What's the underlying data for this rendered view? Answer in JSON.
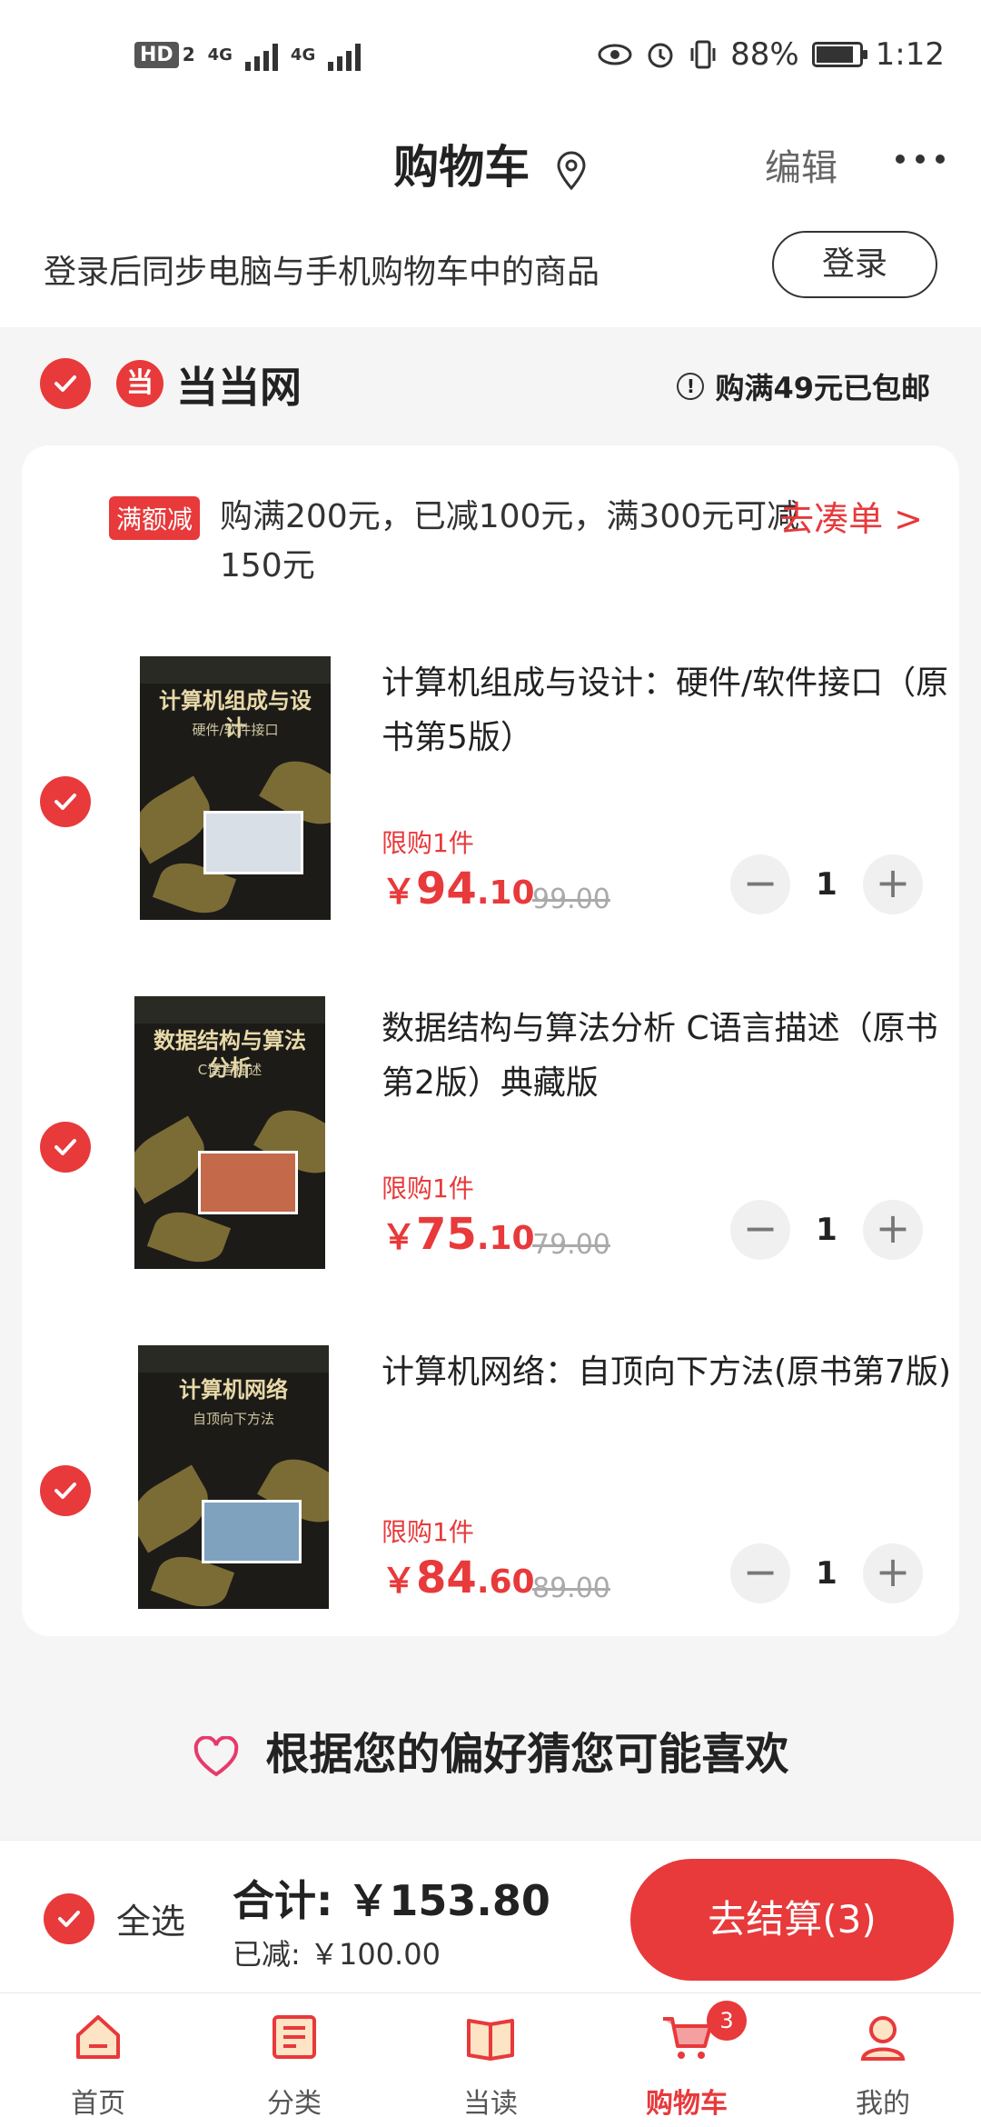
{
  "status_bar": {
    "hd": "HD",
    "sim2": "2",
    "net1": "4G",
    "net2": "4G",
    "battery_percent": "88%",
    "battery_level": 0.88,
    "time": "1:12",
    "icons": [
      "eye-icon",
      "alarm-icon",
      "vibrate-icon"
    ]
  },
  "header": {
    "title": "购物车",
    "edit_label": "编辑"
  },
  "login": {
    "message": "登录后同步电脑与手机购物车中的商品",
    "button_label": "登录"
  },
  "shop": {
    "logo_glyph": "当",
    "name": "当当网",
    "shipping_note": "购满49元已包邮"
  },
  "promo": {
    "tag": "满额减",
    "text": "购满200元，已减100元，满300元可减150元",
    "link": "去凑单 >"
  },
  "items": [
    {
      "title": "计算机组成与设计：硬件/软件接口（原书第5版）",
      "cover_title": "计算机组成与设计",
      "cover_subtitle": "硬件/软件接口",
      "limit": "限购1件",
      "price_symbol": "￥",
      "price_int": "94",
      "price_dec": ".10",
      "original_price": "99.00",
      "quantity": "1",
      "minus": "−",
      "plus": "+"
    },
    {
      "title": "数据结构与算法分析 C语言描述（原书第2版）典藏版",
      "cover_title": "数据结构与算法分析",
      "cover_subtitle": "C语言描述",
      "limit": "限购1件",
      "price_symbol": "￥",
      "price_int": "75",
      "price_dec": ".10",
      "original_price": "79.00",
      "quantity": "1",
      "minus": "−",
      "plus": "+"
    },
    {
      "title": "计算机网络：自顶向下方法(原书第7版)",
      "cover_title": "计算机网络",
      "cover_subtitle": "自顶向下方法",
      "limit": "限购1件",
      "price_symbol": "￥",
      "price_int": "84",
      "price_dec": ".60",
      "original_price": "89.00",
      "quantity": "1",
      "minus": "−",
      "plus": "+"
    }
  ],
  "recommend": {
    "title": "根据您的偏好猜您可能喜欢"
  },
  "checkout": {
    "select_all": "全选",
    "total": "合计: ￥153.80",
    "reduced": "已减: ￥100.00",
    "pay_button": "去结算(3)"
  },
  "tabs": [
    {
      "label": "首页",
      "icon": "home-icon"
    },
    {
      "label": "分类",
      "icon": "category-icon"
    },
    {
      "label": "当读",
      "icon": "book-icon"
    },
    {
      "label": "购物车",
      "icon": "cart-icon",
      "badge": "3",
      "active": true
    },
    {
      "label": "我的",
      "icon": "profile-icon"
    }
  ],
  "colors": {
    "accent": "#e8393b"
  }
}
